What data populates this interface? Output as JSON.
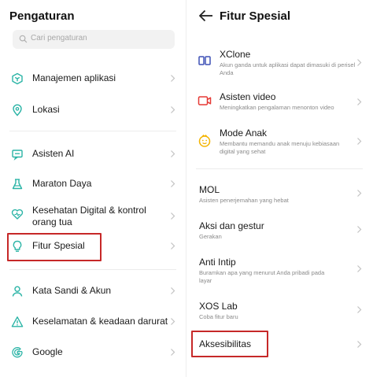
{
  "left": {
    "title": "Pengaturan",
    "search": {
      "placeholder": "Cari pengaturan"
    },
    "items": [
      {
        "label": "Manajemen aplikasi",
        "icon": "app-management-icon"
      },
      {
        "label": "Lokasi",
        "icon": "location-icon"
      },
      {
        "label": "Asisten AI",
        "icon": "ai-assistant-icon"
      },
      {
        "label": "Maraton Daya",
        "icon": "flask-icon"
      },
      {
        "label": "Kesehatan Digital & kontrol orang tua",
        "icon": "digital-wellbeing-icon"
      },
      {
        "label": "Fitur Spesial",
        "icon": "special-feature-icon"
      },
      {
        "label": "Kata Sandi & Akun",
        "icon": "user-icon"
      },
      {
        "label": "Keselamatan & keadaan darurat",
        "icon": "warning-icon"
      },
      {
        "label": "Google",
        "icon": "google-icon"
      }
    ]
  },
  "right": {
    "title": "Fitur Spesial",
    "items": [
      {
        "title": "XClone",
        "subtitle": "Akun ganda untuk aplikasi dapat dimasuki di perisel Anda",
        "icon": "xclone-icon"
      },
      {
        "title": "Asisten video",
        "subtitle": "Meningkatkan pengalaman menonton video",
        "icon": "video-assistant-icon"
      },
      {
        "title": "Mode Anak",
        "subtitle": "Membantu memandu anak menuju kebiasaan digital yang sehat",
        "icon": "kids-mode-icon"
      },
      {
        "title": "MOL",
        "subtitle": "Asisten penerjemahan yang hebat"
      },
      {
        "title": "Aksi dan gestur",
        "subtitle": "Gerakan"
      },
      {
        "title": "Anti Intip",
        "subtitle": "Buramkan apa yang menurut Anda pribadi pada layar"
      },
      {
        "title": "XOS Lab",
        "subtitle": "Coba fitur baru"
      },
      {
        "title": "Aksesibilitas",
        "subtitle": ""
      }
    ]
  },
  "colors": {
    "accent": "#2bb4a6",
    "highlight": "#c62828",
    "video": "#e53935",
    "kids": "#f4b400",
    "xclone": "#3f51b5"
  }
}
